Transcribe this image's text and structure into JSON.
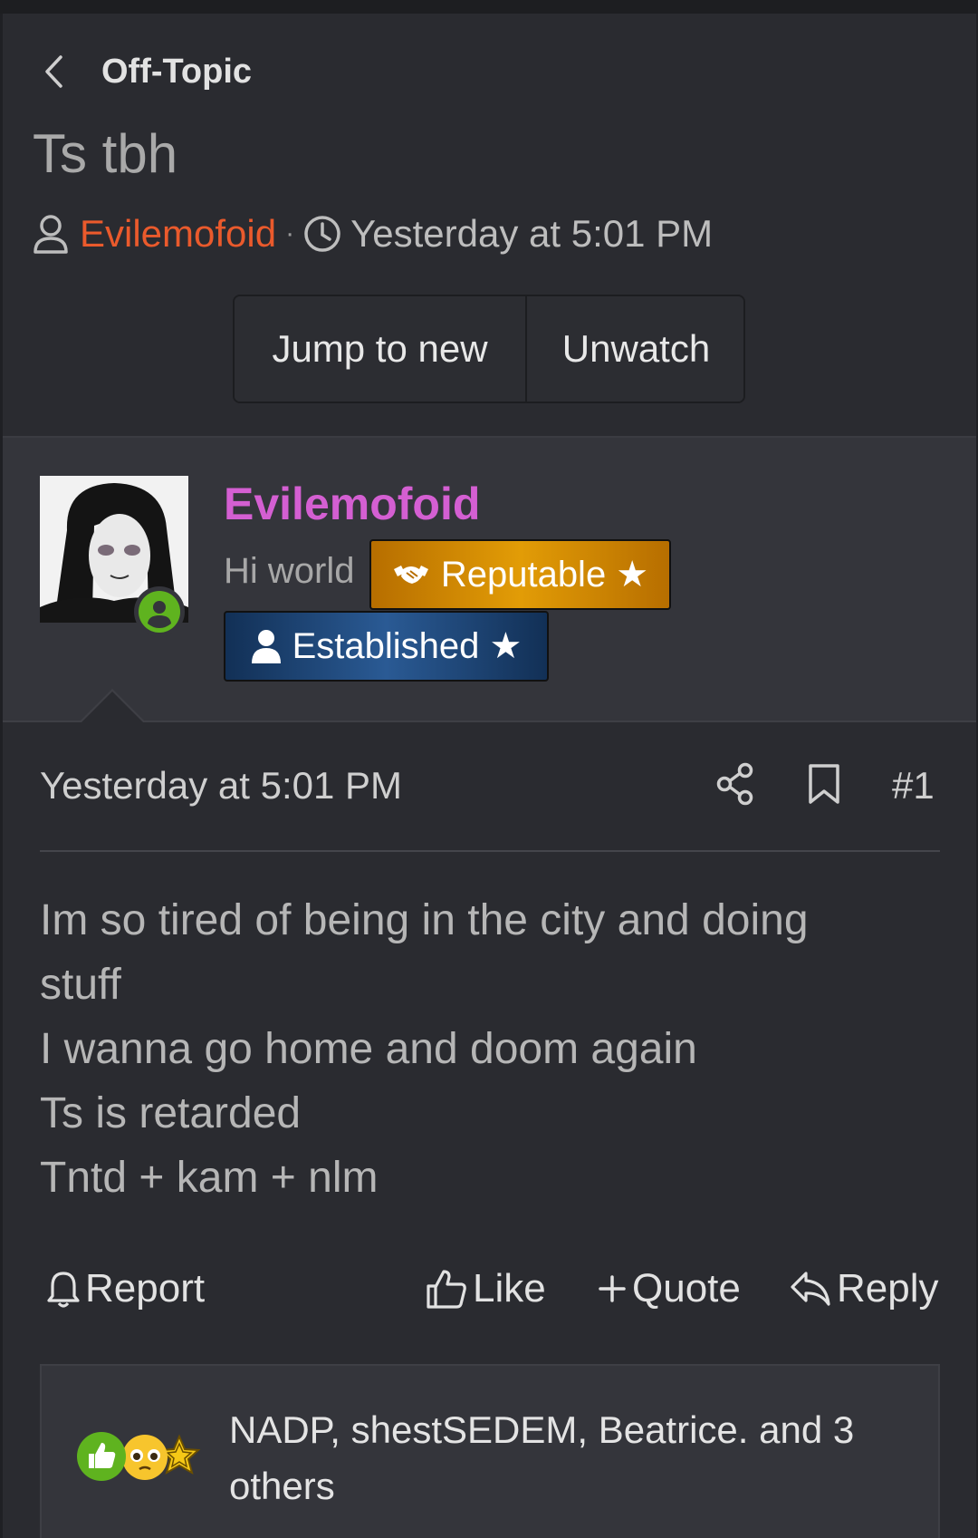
{
  "breadcrumb": {
    "label": "Off-Topic"
  },
  "thread": {
    "title": "Ts tbh",
    "author": "Evilemofoid",
    "separator": "·",
    "time": "Yesterday at 5:01 PM"
  },
  "buttons": {
    "jump_new": "Jump to new",
    "unwatch": "Unwatch"
  },
  "user": {
    "name": "Evilemofoid",
    "title": "Hi world",
    "badges": [
      {
        "label": "Reputable ★",
        "color": "#e29c06"
      },
      {
        "label": "Established ★",
        "color": "#2a5a94"
      }
    ],
    "online_color": "#5fb31f"
  },
  "post": {
    "date": "Yesterday at 5:01 PM",
    "number": "#1",
    "lines": [
      "Im so tired of being in the city and doing",
      "stuff",
      "I wanna go home and doom again",
      "Ts is retarded",
      "Tntd + kam + nlm"
    ]
  },
  "actions": {
    "report": "Report",
    "like": "Like",
    "quote": "Quote",
    "reply": "Reply"
  },
  "reactions": {
    "icons": [
      "thumbs-up",
      "pleading-face",
      "star"
    ],
    "line1": "NADP, shestSEDEM, Beatrice. and 3",
    "line2": "others"
  },
  "colors": {
    "author": "#ea5a2c",
    "username": "#d45fd2",
    "background": "#2a2b30"
  }
}
